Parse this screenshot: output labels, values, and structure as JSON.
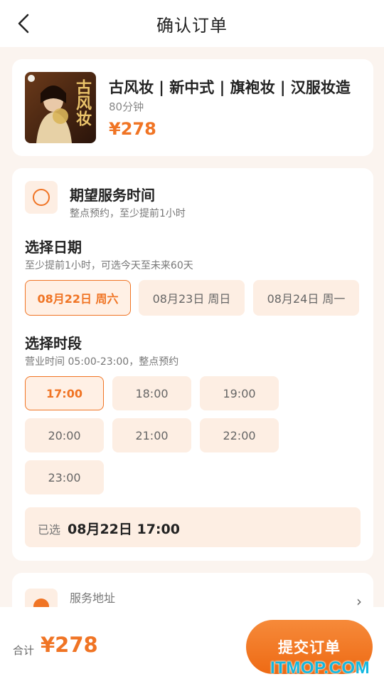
{
  "header": {
    "title": "确认订单"
  },
  "product": {
    "name": "古风妆 | 新中式 | 旗袍妆 | 汉服妆造",
    "duration": "80分钟",
    "price": "¥278",
    "thumb_text": "古风妆"
  },
  "time_section": {
    "title": "期望服务时间",
    "subtitle": "整点预约，至少提前1小时",
    "date_label": "选择日期",
    "date_hint": "至少提前1小时，可选今天至未来60天",
    "dates": [
      {
        "label": "08月22日 周六",
        "selected": true
      },
      {
        "label": "08月23日 周日",
        "selected": false
      },
      {
        "label": "08月24日 周一",
        "selected": false
      }
    ],
    "slot_label": "选择时段",
    "slot_hint": "营业时间 05:00-23:00，整点预约",
    "slots": [
      {
        "label": "17:00",
        "selected": true
      },
      {
        "label": "18:00",
        "selected": false
      },
      {
        "label": "19:00",
        "selected": false
      },
      {
        "label": "20:00",
        "selected": false
      },
      {
        "label": "21:00",
        "selected": false
      },
      {
        "label": "22:00",
        "selected": false
      },
      {
        "label": "23:00",
        "selected": false
      }
    ],
    "selected_prefix": "已选",
    "selected_value": "08月22日 17:00"
  },
  "address": {
    "label": "服务地址",
    "chevron": "›"
  },
  "footer": {
    "total_label": "合计",
    "total_value": "¥278",
    "submit_label": "提交订单"
  },
  "watermark": "ITMOP.COM",
  "colors": {
    "accent": "#f07424",
    "chip_bg": "#fdeee3",
    "page_bg": "#fbf4ef"
  },
  "icons": {
    "back": "chevron-left-icon",
    "time": "clock-ring-icon",
    "address": "location-pin-icon",
    "arrow": "chevron-right-icon"
  }
}
